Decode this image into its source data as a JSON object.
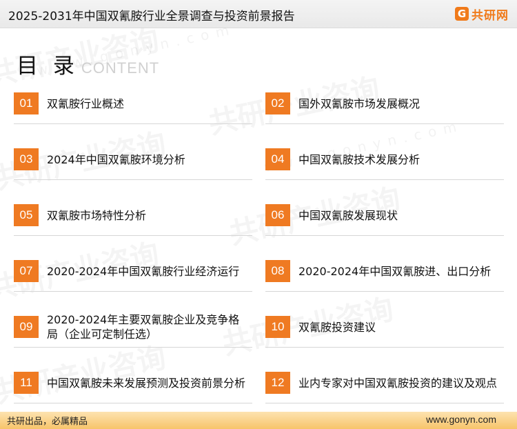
{
  "header": {
    "title": "2025-2031年中国双氰胺行业全景调查与投资前景报告",
    "logo": {
      "icon": "G",
      "text": "共研网"
    }
  },
  "toc": {
    "title": "目 录",
    "subtitle": "CONTENT",
    "items": [
      {
        "num": "01",
        "label": "双氰胺行业概述"
      },
      {
        "num": "02",
        "label": "国外双氰胺市场发展概况"
      },
      {
        "num": "03",
        "label": "2024年中国双氰胺环境分析"
      },
      {
        "num": "04",
        "label": "中国双氰胺技术发展分析"
      },
      {
        "num": "05",
        "label": "双氰胺市场特性分析"
      },
      {
        "num": "06",
        "label": "中国双氰胺发展现状"
      },
      {
        "num": "07",
        "label": "2020-2024年中国双氰胺行业经济运行"
      },
      {
        "num": "08",
        "label": "2020-2024年中国双氰胺进、出口分析"
      },
      {
        "num": "09",
        "label": "2020-2024年主要双氰胺企业及竞争格局（企业可定制任选）"
      },
      {
        "num": "10",
        "label": "双氰胺投资建议"
      },
      {
        "num": "11",
        "label": "中国双氰胺未来发展预测及投资前景分析"
      },
      {
        "num": "12",
        "label": "业内专家对中国双氰胺投资的建议及观点"
      }
    ]
  },
  "watermark": {
    "text": "共研产业咨询",
    "sub": "www.gonyn.com"
  },
  "footer": {
    "slogan": "共研出品，必属精品",
    "url": "www.gonyn.com"
  },
  "colors": {
    "accent": "#ef7a22",
    "footer": "#f7c46a"
  }
}
